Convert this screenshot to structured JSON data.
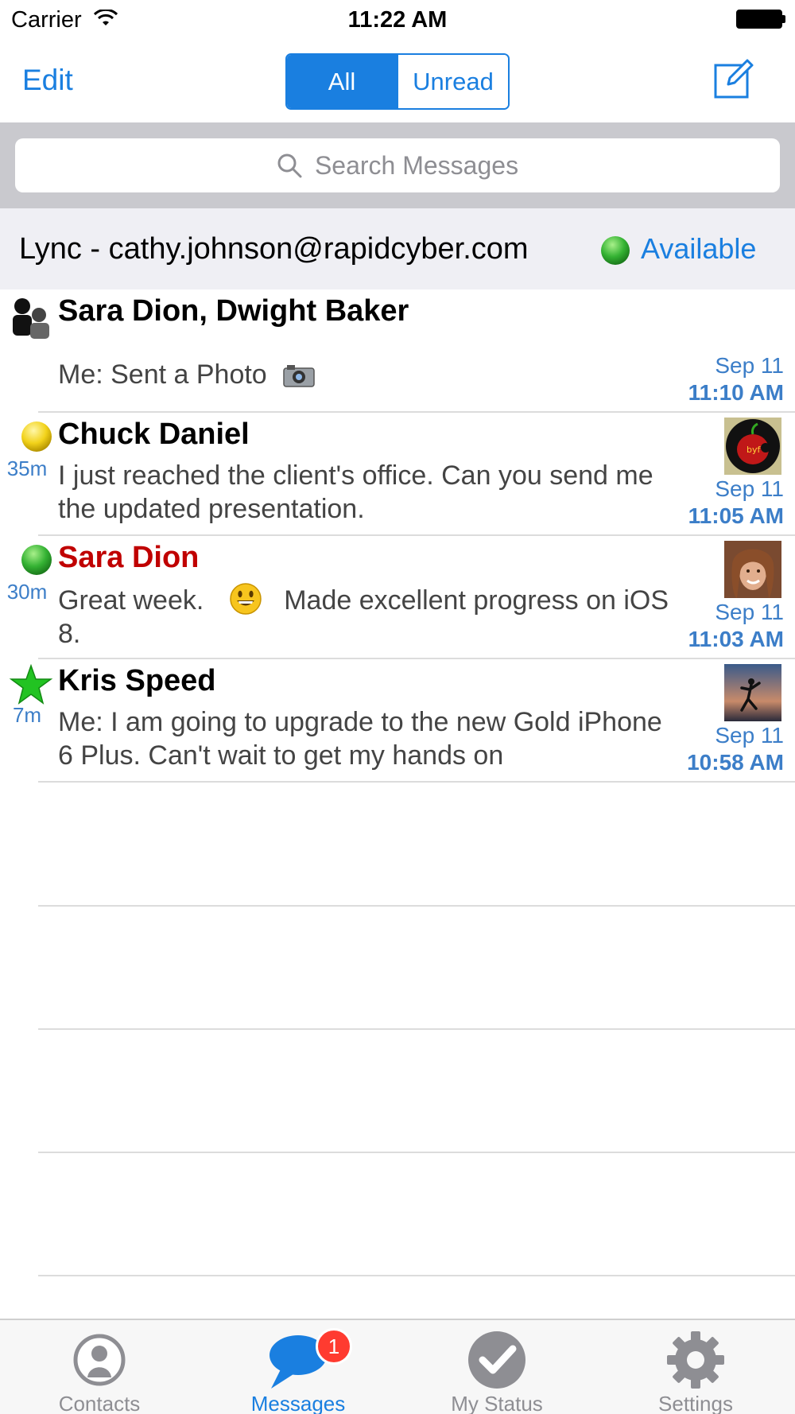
{
  "status_bar": {
    "carrier": "Carrier",
    "time": "11:22 AM"
  },
  "nav": {
    "edit_label": "Edit",
    "segments": [
      {
        "label": "All",
        "selected": true
      },
      {
        "label": "Unread",
        "selected": false
      }
    ]
  },
  "search": {
    "placeholder": "Search Messages"
  },
  "account": {
    "label": "Lync - cathy.johnson@rapidcyber.com",
    "status": "Available",
    "status_color": "#34b233"
  },
  "conversations": [
    {
      "name": "Sara Dion, Dwight Baker",
      "preview": "Me: Sent a Photo",
      "attachment_icon": "camera-icon",
      "lead_icon": "group-icon",
      "since": "",
      "date": "Sep 11",
      "time": "11:10 AM",
      "name_color": "#000000"
    },
    {
      "name": "Chuck Daniel",
      "preview": "I just reached the client's office. Can you send me the updated presentation.",
      "lead_icon": "away-status-icon",
      "since": "35m",
      "date": "Sep 11",
      "time": "11:05 AM",
      "name_color": "#000000"
    },
    {
      "name": "Sara Dion",
      "preview_before": "Great week.",
      "preview_after": "Made excellent progress on iOS 8.",
      "inline_icon": "smiley-emoji-icon",
      "lead_icon": "available-status-icon",
      "since": "30m",
      "date": "Sep 11",
      "time": "11:03 AM",
      "name_color": "#c00000"
    },
    {
      "name": "Kris Speed",
      "preview": "Me: I am going to upgrade to the new Gold iPhone 6 Plus.  Can't wait to get my hands on",
      "lead_icon": "favorite-star-icon",
      "since": "7m",
      "date": "Sep 11",
      "time": "10:58 AM",
      "name_color": "#000000"
    }
  ],
  "tabs": [
    {
      "label": "Contacts",
      "icon": "contacts-icon",
      "active": false
    },
    {
      "label": "Messages",
      "icon": "messages-icon",
      "active": true,
      "badge": "1"
    },
    {
      "label": "My Status",
      "icon": "my-status-icon",
      "active": false
    },
    {
      "label": "Settings",
      "icon": "settings-gear-icon",
      "active": false
    }
  ],
  "colors": {
    "accent": "#1a7fe0",
    "timestamp": "#3c7ec8",
    "away": "#f2d21a",
    "badge": "#ff3b30"
  }
}
